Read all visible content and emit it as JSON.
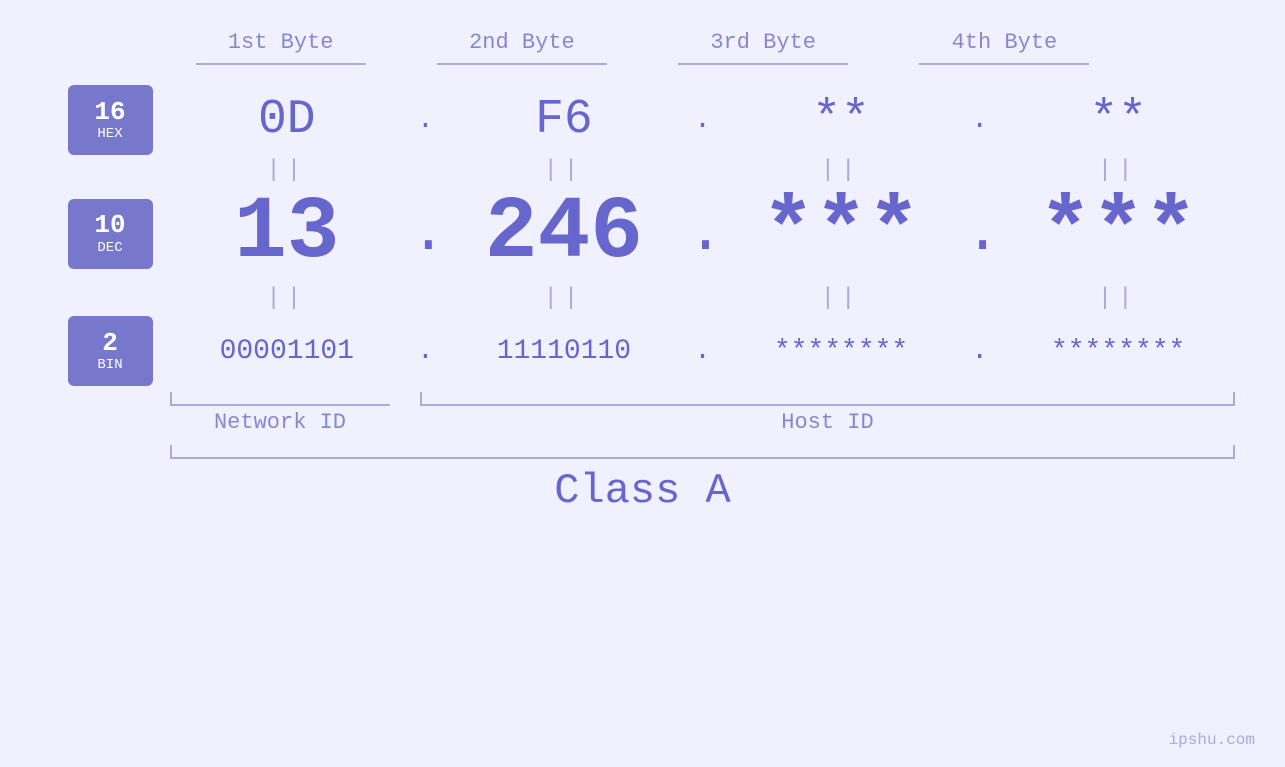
{
  "page": {
    "background": "#f0f0ff",
    "watermark": "ipshu.com"
  },
  "byte_headers": {
    "labels": [
      "1st Byte",
      "2nd Byte",
      "3rd Byte",
      "4th Byte"
    ]
  },
  "badges": [
    {
      "num": "16",
      "label": "HEX"
    },
    {
      "num": "10",
      "label": "DEC"
    },
    {
      "num": "2",
      "label": "BIN"
    }
  ],
  "hex_row": {
    "values": [
      "0D",
      "F6",
      "**",
      "**"
    ],
    "dots": [
      ".",
      ".",
      "."
    ]
  },
  "dec_row": {
    "values": [
      "13",
      "246",
      "***",
      "***"
    ],
    "dots": [
      ".",
      ".",
      "."
    ]
  },
  "bin_row": {
    "values": [
      "00001101",
      "11110110",
      "********",
      "********"
    ],
    "dots": [
      ".",
      ".",
      "."
    ]
  },
  "eq_symbol": "||",
  "labels": {
    "network_id": "Network ID",
    "host_id": "Host ID",
    "class": "Class A"
  }
}
